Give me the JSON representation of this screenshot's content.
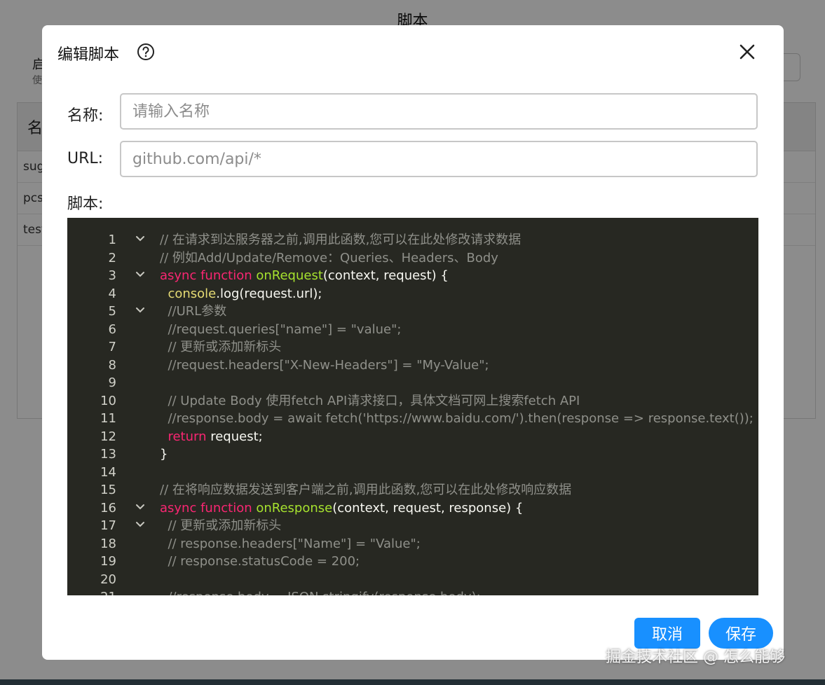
{
  "background": {
    "title": "脚本",
    "hint_title": "启",
    "hint_sub": "使",
    "table_header": "名",
    "rows": [
      "sug",
      "pcs",
      "test"
    ]
  },
  "modal": {
    "title": "编辑脚本",
    "name_label": "名称:",
    "name_placeholder": "请输入名称",
    "url_label": "URL:",
    "url_placeholder": "github.com/api/*",
    "script_label": "脚本:",
    "cancel_label": "取消",
    "save_label": "保存"
  },
  "editor": {
    "lines": [
      {
        "n": "1",
        "fold": true,
        "parts": [
          {
            "t": "// 在请求到达服务器之前,调用此函数,您可以在此处修改请求数据",
            "c": "comment"
          }
        ]
      },
      {
        "n": "2",
        "fold": false,
        "parts": [
          {
            "t": "// 例如Add/Update/Remove：Queries、Headers、Body",
            "c": "comment"
          }
        ]
      },
      {
        "n": "3",
        "fold": true,
        "parts": [
          {
            "t": "async function ",
            "c": "kw"
          },
          {
            "t": "onRequest",
            "c": "fn"
          },
          {
            "t": "(context, request) {",
            "c": "plain"
          }
        ]
      },
      {
        "n": "4",
        "fold": false,
        "parts": [
          {
            "t": "  ",
            "c": "plain"
          },
          {
            "t": "console",
            "c": "obj"
          },
          {
            "t": ".log(request.url);",
            "c": "plain"
          }
        ]
      },
      {
        "n": "5",
        "fold": true,
        "parts": [
          {
            "t": "  //URL参数",
            "c": "comment"
          }
        ]
      },
      {
        "n": "6",
        "fold": false,
        "parts": [
          {
            "t": "  //request.queries[\"name\"] = \"value\";",
            "c": "comment"
          }
        ]
      },
      {
        "n": "7",
        "fold": false,
        "parts": [
          {
            "t": "  // 更新或添加新标头",
            "c": "comment"
          }
        ]
      },
      {
        "n": "8",
        "fold": false,
        "parts": [
          {
            "t": "  //request.headers[\"X-New-Headers\"] = \"My-Value\";",
            "c": "comment"
          }
        ]
      },
      {
        "n": "9",
        "fold": false,
        "parts": [
          {
            "t": "",
            "c": "plain"
          }
        ]
      },
      {
        "n": "10",
        "fold": false,
        "parts": [
          {
            "t": "  // Update Body 使用fetch API请求接口，具体文档可网上搜索fetch API",
            "c": "comment"
          }
        ]
      },
      {
        "n": "11",
        "fold": false,
        "parts": [
          {
            "t": "  //response.body = await fetch('https://www.baidu.com/').then(response => response.text());",
            "c": "comment"
          }
        ]
      },
      {
        "n": "12",
        "fold": false,
        "parts": [
          {
            "t": "  ",
            "c": "plain"
          },
          {
            "t": "return",
            "c": "kw"
          },
          {
            "t": " request;",
            "c": "plain"
          }
        ]
      },
      {
        "n": "13",
        "fold": false,
        "parts": [
          {
            "t": "}",
            "c": "plain"
          }
        ]
      },
      {
        "n": "14",
        "fold": false,
        "parts": [
          {
            "t": "",
            "c": "plain"
          }
        ]
      },
      {
        "n": "15",
        "fold": false,
        "parts": [
          {
            "t": "// 在将响应数据发送到客户端之前,调用此函数,您可以在此处修改响应数据",
            "c": "comment"
          }
        ]
      },
      {
        "n": "16",
        "fold": true,
        "parts": [
          {
            "t": "async function ",
            "c": "kw"
          },
          {
            "t": "onResponse",
            "c": "fn"
          },
          {
            "t": "(context, request, response) {",
            "c": "plain"
          }
        ]
      },
      {
        "n": "17",
        "fold": true,
        "parts": [
          {
            "t": "  // 更新或添加新标头",
            "c": "comment"
          }
        ]
      },
      {
        "n": "18",
        "fold": false,
        "parts": [
          {
            "t": "  // response.headers[\"Name\"] = \"Value\";",
            "c": "comment"
          }
        ]
      },
      {
        "n": "19",
        "fold": false,
        "parts": [
          {
            "t": "  // response.statusCode = 200;",
            "c": "comment"
          }
        ]
      },
      {
        "n": "20",
        "fold": false,
        "parts": [
          {
            "t": "",
            "c": "plain"
          }
        ]
      },
      {
        "n": "21",
        "fold": false,
        "parts": [
          {
            "t": "  //response.body = JSON.stringify(response.body);",
            "c": "comment"
          }
        ]
      }
    ]
  },
  "watermark": "掘金技术社区 @ 怎么能够"
}
